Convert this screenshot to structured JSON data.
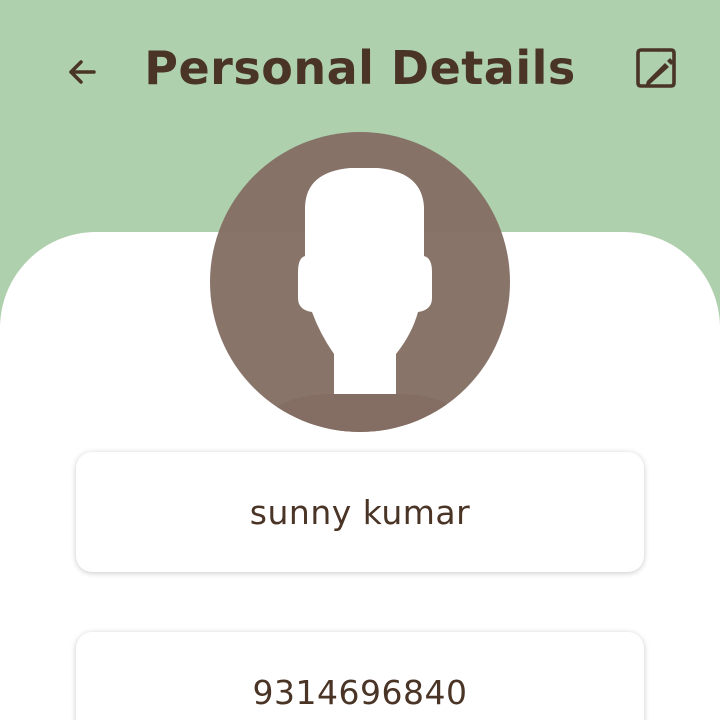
{
  "header": {
    "title": "Personal Details",
    "back_icon": "arrow-left-icon",
    "edit_icon": "edit-icon"
  },
  "profile": {
    "avatar_icon": "person-silhouette-icon",
    "name": "sunny kumar",
    "phone": "9314696840"
  },
  "colors": {
    "header_background": "#afd0ad",
    "text_primary": "#4a3426",
    "avatar": "#846e64",
    "card_background": "#ffffff"
  }
}
